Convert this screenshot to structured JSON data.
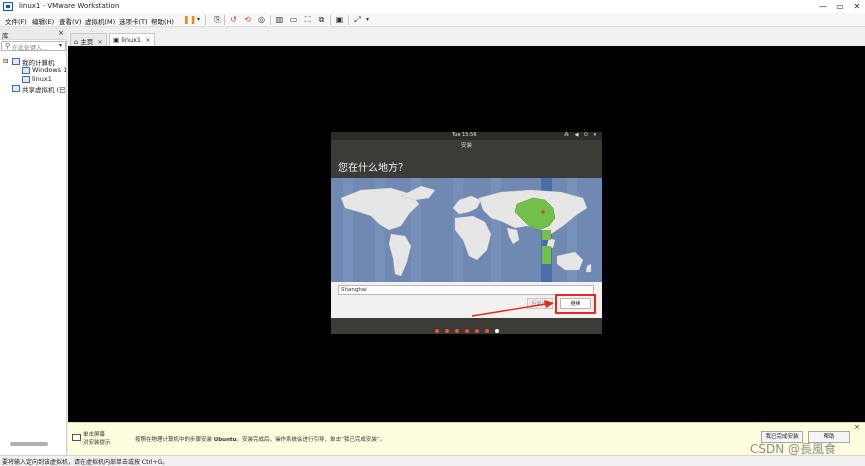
{
  "window": {
    "title": "linux1 - VMware Workstation",
    "controls": [
      "—",
      "▭",
      "✕"
    ]
  },
  "menu": {
    "items": [
      "文件(F)",
      "编辑(E)",
      "查看(V)",
      "虚拟机(M)",
      "选项卡(T)",
      "帮助(H)"
    ]
  },
  "library": {
    "title": "库",
    "close": "×",
    "search_placeholder": "在此处键入...",
    "tree": {
      "my_computer": "我的计算机",
      "windows": "Windows 10",
      "linux": "linux1",
      "shared": "共享虚拟机 (已弃"
    }
  },
  "tabs": [
    {
      "label": "主页",
      "close": "×"
    },
    {
      "label": "linux1",
      "close": "×"
    }
  ],
  "installer": {
    "time": "Tue 15:56",
    "tray": "⁂ ◀ ⏻ ▾",
    "window_title": "安装",
    "heading": "您在什么地方？",
    "timezone_value": "Shanghai",
    "back_label": "后退(B)",
    "continue_label": "继续",
    "progress": {
      "total": 7,
      "current": 7
    }
  },
  "hint_bar": {
    "left_text_1": "单击屏幕",
    "left_text_2": "对安装",
    "left_text_3": "提示",
    "main_prefix": "按照在物理计算机中的步骤安装",
    "main_os": "Ubuntu",
    "main_suffix": "。安装完成后，操作系统会进行引导，单击“我已完成安装”。",
    "done_button": "我已完成安装",
    "help_button": "帮助",
    "close": "×"
  },
  "status": {
    "text": "要将输入定向到该虚拟机，请在虚拟机内部单击或按 Ctrl+G。"
  },
  "watermark": "CSDN @長風食",
  "colors": {
    "accent_orange": "#e0573a",
    "highlight_red": "#e22a1e",
    "map_ocean": "#6f89b2",
    "map_land": "#e6e6e6",
    "map_selected": "#72c04a"
  }
}
